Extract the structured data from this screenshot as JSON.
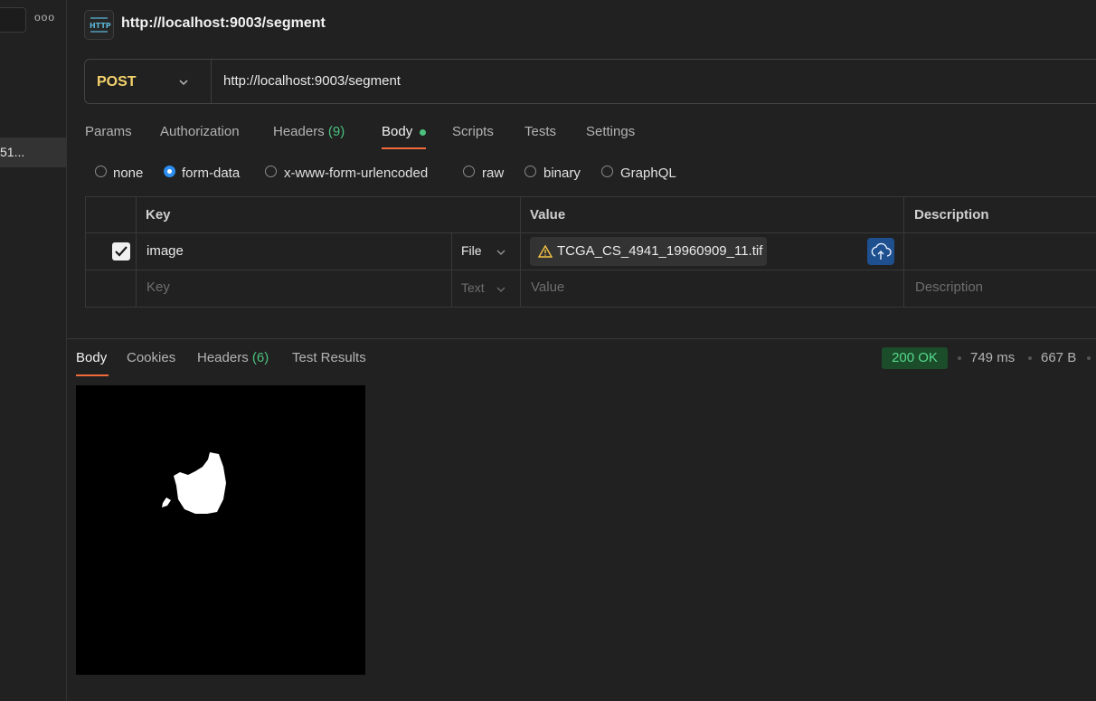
{
  "sidebar": {
    "more_icon": "ooo",
    "item_label": "51..."
  },
  "request": {
    "title": "http://localhost:9003/segment",
    "method": "POST",
    "url": "http://localhost:9003/segment",
    "tabs": [
      {
        "label": "Params"
      },
      {
        "label": "Authorization"
      },
      {
        "label": "Headers",
        "count": "(9)"
      },
      {
        "label": "Body"
      },
      {
        "label": "Scripts"
      },
      {
        "label": "Tests"
      },
      {
        "label": "Settings"
      }
    ],
    "active_tab": "Body",
    "body_types": [
      "none",
      "form-data",
      "x-www-form-urlencoded",
      "raw",
      "binary",
      "GraphQL"
    ],
    "selected_body_type": "form-data",
    "table": {
      "headers": [
        "Key",
        "Value",
        "Description"
      ],
      "rows": [
        {
          "checked": true,
          "key": "image",
          "type": "File",
          "value": "TCGA_CS_4941_19960909_11.tif",
          "description": ""
        }
      ],
      "placeholder": {
        "key": "Key",
        "type": "Text",
        "value": "Value",
        "description": "Description"
      }
    }
  },
  "response": {
    "tabs": [
      {
        "label": "Body"
      },
      {
        "label": "Cookies"
      },
      {
        "label": "Headers",
        "count": "(6)"
      },
      {
        "label": "Test Results"
      }
    ],
    "status": "200 OK",
    "time": "749 ms",
    "size": "667 B"
  },
  "colors": {
    "accent": "#f26b3a",
    "method": "#f5d36b",
    "success": "#55d88a",
    "radio_selected": "#2b8ef0",
    "upload_button": "#1e4f8f"
  },
  "icons": [
    "http-icon",
    "chevron-down-icon",
    "checkbox-icon",
    "warning-icon",
    "cloud-upload-icon",
    "more-icon"
  ]
}
